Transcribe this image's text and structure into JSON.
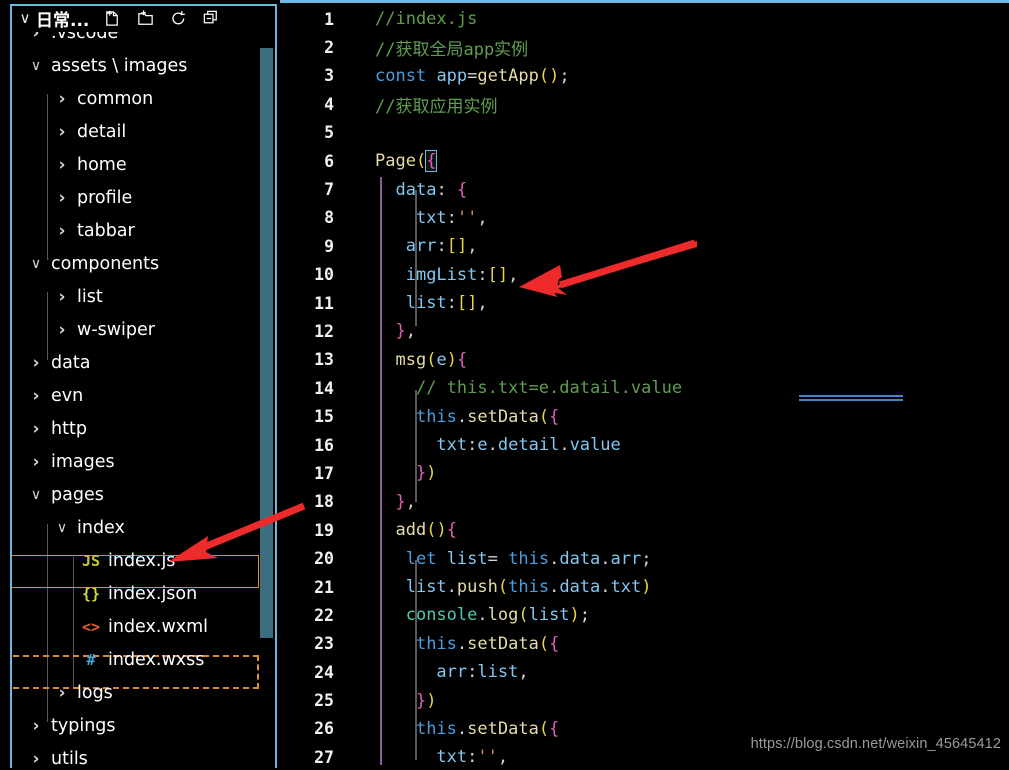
{
  "sidebar": {
    "header": {
      "chevron": "∨",
      "title": "日常...",
      "actions": [
        {
          "name": "new-file-icon",
          "tooltip": "New File"
        },
        {
          "name": "new-folder-icon",
          "tooltip": "New Folder"
        },
        {
          "name": "refresh-icon",
          "tooltip": "Refresh Explorer"
        },
        {
          "name": "collapse-all-icon",
          "tooltip": "Collapse Folders in Explorer"
        }
      ]
    },
    "tree": [
      {
        "label": ".vscode",
        "kind": "folder",
        "state": "collapsed",
        "depth": 1,
        "icon": "chevron-right-icon",
        "clipped": true
      },
      {
        "label": "assets \\ images",
        "kind": "folder",
        "state": "expanded",
        "depth": 1,
        "icon": "chevron-down-icon"
      },
      {
        "label": "common",
        "kind": "folder",
        "state": "collapsed",
        "depth": 2,
        "icon": "chevron-right-icon"
      },
      {
        "label": "detail",
        "kind": "folder",
        "state": "collapsed",
        "depth": 2,
        "icon": "chevron-right-icon"
      },
      {
        "label": "home",
        "kind": "folder",
        "state": "collapsed",
        "depth": 2,
        "icon": "chevron-right-icon"
      },
      {
        "label": "profile",
        "kind": "folder",
        "state": "collapsed",
        "depth": 2,
        "icon": "chevron-right-icon"
      },
      {
        "label": "tabbar",
        "kind": "folder",
        "state": "collapsed",
        "depth": 2,
        "icon": "chevron-right-icon"
      },
      {
        "label": "components",
        "kind": "folder",
        "state": "expanded",
        "depth": 1,
        "icon": "chevron-down-icon"
      },
      {
        "label": "list",
        "kind": "folder",
        "state": "collapsed",
        "depth": 2,
        "icon": "chevron-right-icon"
      },
      {
        "label": "w-swiper",
        "kind": "folder",
        "state": "collapsed",
        "depth": 2,
        "icon": "chevron-right-icon"
      },
      {
        "label": "data",
        "kind": "folder",
        "state": "collapsed",
        "depth": 1,
        "icon": "chevron-right-icon"
      },
      {
        "label": "evn",
        "kind": "folder",
        "state": "collapsed",
        "depth": 1,
        "icon": "chevron-right-icon"
      },
      {
        "label": "http",
        "kind": "folder",
        "state": "collapsed",
        "depth": 1,
        "icon": "chevron-right-icon"
      },
      {
        "label": "images",
        "kind": "folder",
        "state": "collapsed",
        "depth": 1,
        "icon": "chevron-right-icon"
      },
      {
        "label": "pages",
        "kind": "folder",
        "state": "expanded",
        "depth": 1,
        "icon": "chevron-down-icon"
      },
      {
        "label": "index",
        "kind": "folder",
        "state": "expanded",
        "depth": 2,
        "icon": "chevron-down-icon"
      },
      {
        "label": "index.js",
        "kind": "file",
        "depth": 3,
        "icon": "js-file-icon",
        "badge": "JS",
        "badge_color": "#c9c927",
        "selected": true
      },
      {
        "label": "index.json",
        "kind": "file",
        "depth": 3,
        "icon": "json-file-icon",
        "badge": "{}",
        "badge_color": "#d6d63a"
      },
      {
        "label": "index.wxml",
        "kind": "file",
        "depth": 3,
        "icon": "xml-file-icon",
        "badge": "<>",
        "badge_color": "#e0622a"
      },
      {
        "label": "index.wxss",
        "kind": "file",
        "depth": 3,
        "icon": "css-file-icon",
        "badge": "#",
        "badge_color": "#4aa3d8",
        "highlighted": true
      },
      {
        "label": "logs",
        "kind": "folder",
        "state": "collapsed",
        "depth": 2,
        "icon": "chevron-right-icon"
      },
      {
        "label": "typings",
        "kind": "folder",
        "state": "collapsed",
        "depth": 1,
        "icon": "chevron-right-icon"
      },
      {
        "label": "utils",
        "kind": "folder",
        "state": "collapsed",
        "depth": 1,
        "icon": "chevron-right-icon"
      }
    ],
    "colors": {
      "panel_border": "#6cb8e0",
      "scrollbar": "#3d6e80",
      "selection_outline": "#e08b2a"
    }
  },
  "editor": {
    "first_line_number": 1,
    "last_line_number": 27,
    "lines": [
      {
        "n": 1,
        "text": "//index.js"
      },
      {
        "n": 2,
        "text": "//获取全局app实例"
      },
      {
        "n": 3,
        "text": "const app=getApp();"
      },
      {
        "n": 4,
        "text": "//获取应用实例"
      },
      {
        "n": 5,
        "text": ""
      },
      {
        "n": 6,
        "text": "Page({"
      },
      {
        "n": 7,
        "text": "  data: {"
      },
      {
        "n": 8,
        "text": "    txt:'',"
      },
      {
        "n": 9,
        "text": "   arr:[],"
      },
      {
        "n": 10,
        "text": "   imgList:[],"
      },
      {
        "n": 11,
        "text": "   list:[],"
      },
      {
        "n": 12,
        "text": "  },"
      },
      {
        "n": 13,
        "text": "  msg(e){"
      },
      {
        "n": 14,
        "text": "    // this.txt=e.datail.value"
      },
      {
        "n": 15,
        "text": "    this.setData({"
      },
      {
        "n": 16,
        "text": "      txt:e.detail.value"
      },
      {
        "n": 17,
        "text": "    })"
      },
      {
        "n": 18,
        "text": "  },"
      },
      {
        "n": 19,
        "text": "  add(){"
      },
      {
        "n": 20,
        "text": "   let list= this.data.arr;"
      },
      {
        "n": 21,
        "text": "   list.push(this.data.txt)"
      },
      {
        "n": 22,
        "text": "   console.log(list);"
      },
      {
        "n": 23,
        "text": "    this.setData({"
      },
      {
        "n": 24,
        "text": "      arr:list,"
      },
      {
        "n": 25,
        "text": "    })"
      },
      {
        "n": 26,
        "text": "    this.setData({"
      },
      {
        "n": 27,
        "text": "      txt:'',"
      }
    ],
    "spellcheck_word": "datail",
    "colors": {
      "comment": "#5f9e4f",
      "keyword": "#4a9de0",
      "function": "#e6dba8",
      "property": "#83c6f0",
      "bracket_yellow": "#e8d44a",
      "bracket_pink": "#e060b8",
      "bracket_blue": "#4a9de0",
      "string": "#d88a5a",
      "object": "#4ec9b0",
      "background": "#000000",
      "line_number": "#f0f0f0"
    }
  },
  "annotations": {
    "arrows": [
      {
        "name": "arrow-to-list-property",
        "color": "#ee2b2b",
        "from": "(690,243)",
        "to": "(520,303)"
      },
      {
        "name": "arrow-to-index-js-file",
        "color": "#ee2b2b",
        "from": "(300,510)",
        "to": "(168,562)"
      }
    ]
  },
  "watermark": {
    "text": "https://blog.csdn.net/weixin_45645412"
  }
}
